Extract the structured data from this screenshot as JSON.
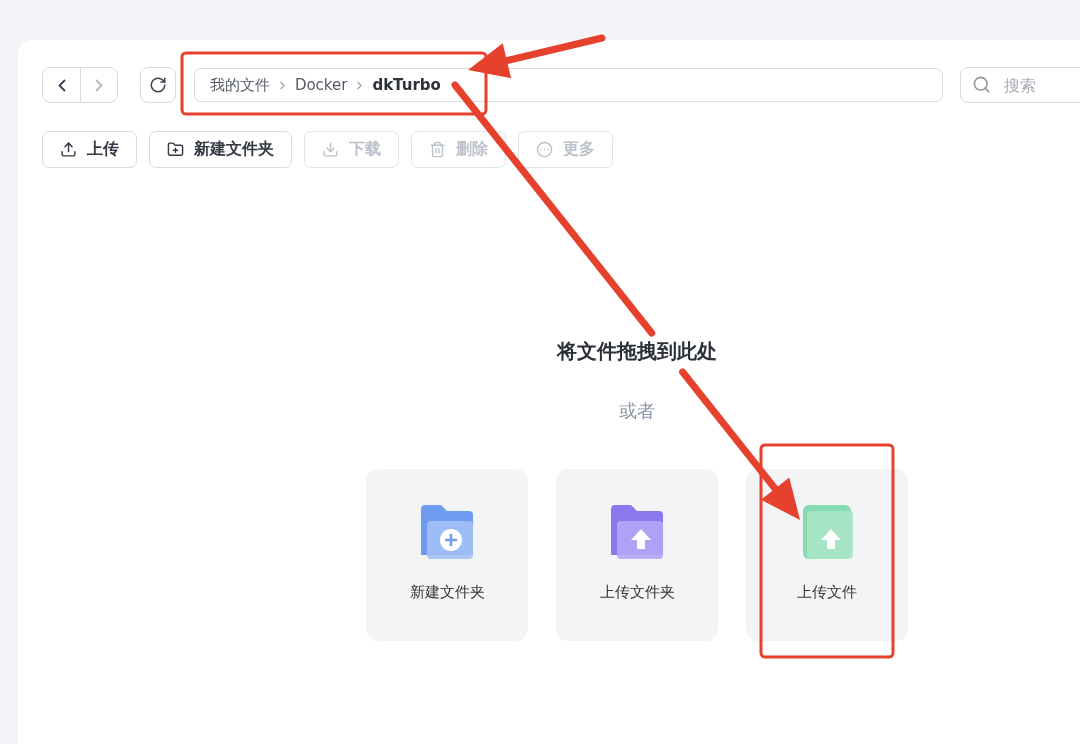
{
  "nav": {
    "back": {
      "disabled": false
    },
    "forward": {
      "disabled": true
    }
  },
  "path": {
    "segments": [
      {
        "label": "我的文件",
        "current": false
      },
      {
        "label": "Docker",
        "current": false
      },
      {
        "label": "dkTurbo",
        "current": true
      }
    ]
  },
  "search": {
    "placeholder": "搜索"
  },
  "toolbar": [
    {
      "label": "上传",
      "disabled": false
    },
    {
      "label": "新建文件夹",
      "disabled": false
    },
    {
      "label": "下载",
      "disabled": true
    },
    {
      "label": "删除",
      "disabled": true
    },
    {
      "label": "更多",
      "disabled": true
    }
  ],
  "drop_zone": {
    "title": "将文件拖拽到此处",
    "or": "或者"
  },
  "actions": [
    {
      "label": "新建文件夹",
      "kind": "new-folder"
    },
    {
      "label": "上传文件夹",
      "kind": "upload-folder"
    },
    {
      "label": "上传文件",
      "kind": "upload-file"
    }
  ],
  "annotations": [
    {
      "kind": "box"
    },
    {
      "kind": "arrow"
    },
    {
      "kind": "arrow"
    },
    {
      "kind": "box"
    }
  ]
}
